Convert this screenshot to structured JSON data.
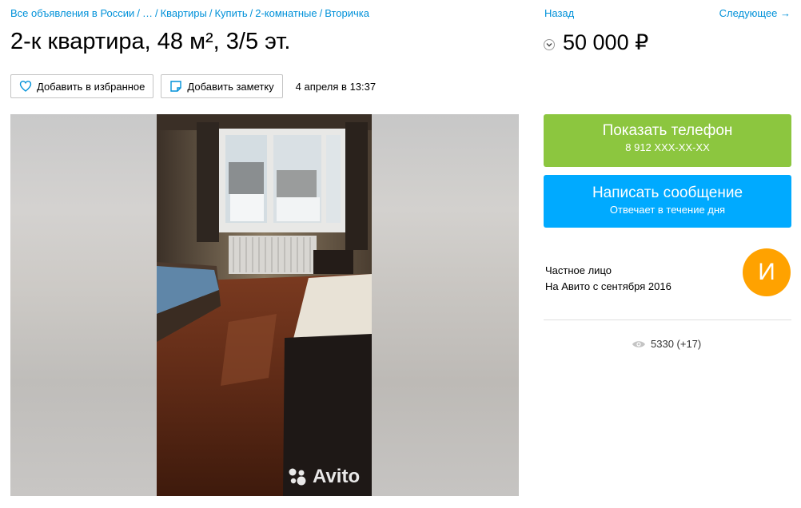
{
  "breadcrumb": {
    "items": [
      "Все объявления в России",
      "…",
      "Квартиры",
      "Купить",
      "2-комнатные",
      "Вторичка"
    ]
  },
  "nav": {
    "back": "Назад",
    "next": "Следующее →"
  },
  "listing": {
    "title": "2-к квартира, 48 м², 3/5 эт.",
    "price": "50 000 ₽",
    "date": "4 апреля в 13:37"
  },
  "actions": {
    "favorite": "Добавить в избранное",
    "note": "Добавить заметку"
  },
  "gallery": {
    "watermark": "Avito"
  },
  "contact": {
    "phone_label": "Показать телефон",
    "phone_number": "8 912 XXX-XX-XX",
    "message_label": "Написать сообщение",
    "message_sub": "Отвечает в течение дня"
  },
  "seller": {
    "type": "Частное лицо",
    "since": "На Авито с сентября 2016",
    "avatar_letter": "И"
  },
  "stats": {
    "views": "5330 (+17)"
  },
  "colors": {
    "link": "#0091d9",
    "phone_button": "#8cc63f",
    "message_button": "#00aaff",
    "avatar": "#ffa200"
  }
}
